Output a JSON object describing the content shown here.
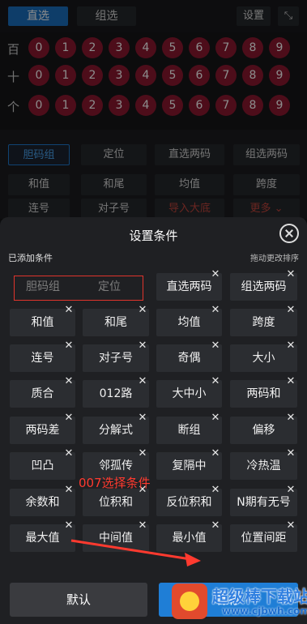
{
  "top": {
    "tab_direct": "直选",
    "tab_group": "组选",
    "settings": "设置"
  },
  "digit_rows": [
    {
      "label": "百",
      "digits": [
        "0",
        "1",
        "2",
        "3",
        "4",
        "5",
        "6",
        "7",
        "8",
        "9"
      ]
    },
    {
      "label": "十",
      "digits": [
        "0",
        "1",
        "2",
        "3",
        "4",
        "5",
        "6",
        "7",
        "8",
        "9"
      ]
    },
    {
      "label": "个",
      "digits": [
        "0",
        "1",
        "2",
        "3",
        "4",
        "5",
        "6",
        "7",
        "8",
        "9"
      ]
    }
  ],
  "upper_conditions": [
    "胆码组",
    "定位",
    "直选两码",
    "组选两码",
    "和值",
    "和尾",
    "均值",
    "跨度",
    "连号",
    "对子号",
    "导入大底",
    "更多 ⌄"
  ],
  "sheet": {
    "title": "设置条件",
    "added_label": "已添加条件",
    "drag_hint": "拖动更改排序",
    "disabled_items": [
      "胆码组",
      "定位"
    ],
    "items": [
      "直选两码",
      "组选两码",
      "和值",
      "和尾",
      "均值",
      "跨度",
      "连号",
      "对子号",
      "奇偶",
      "大小",
      "质合",
      "012路",
      "大中小",
      "两码和",
      "两码差",
      "分解式",
      "断组",
      "偏移",
      "凹凸",
      "邻孤传",
      "复隔中",
      "冷热温",
      "余数和",
      "位积和",
      "反位积和",
      "N期有无号",
      "最大值",
      "中间值",
      "最小值",
      "位置间距"
    ],
    "annotation": "007选择条件"
  },
  "bottom": {
    "default_label": "默认",
    "save_label": "保存"
  },
  "watermark": {
    "name": "超级棒下载站",
    "url": "www.cjbwh.com"
  },
  "colors": {
    "accent": "#1f7ed6",
    "ball": "#8c1930",
    "annotation": "#ff3a2f"
  }
}
